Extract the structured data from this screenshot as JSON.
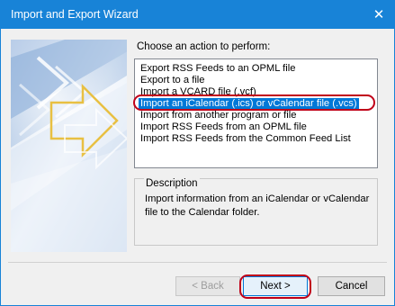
{
  "window": {
    "title": "Import and Export Wizard",
    "close_glyph": "✕",
    "accent_color": "#1883d7"
  },
  "prompt": "Choose an action to perform:",
  "actions": [
    {
      "label": "Export RSS Feeds to an OPML file",
      "selected": false
    },
    {
      "label": "Export to a file",
      "selected": false
    },
    {
      "label": "Import a VCARD file (.vcf)",
      "selected": false
    },
    {
      "label": "Import an iCalendar (.ics) or vCalendar file (.vcs)",
      "selected": true
    },
    {
      "label": "Import from another program or file",
      "selected": false
    },
    {
      "label": "Import RSS Feeds from an OPML file",
      "selected": false
    },
    {
      "label": "Import RSS Feeds from the Common Feed List",
      "selected": false
    }
  ],
  "description": {
    "heading": "Description",
    "text": "Import information from an iCalendar or vCalendar file to the Calendar folder."
  },
  "buttons": {
    "back": "< Back",
    "next": "Next >",
    "cancel": "Cancel"
  },
  "annotation_color": "#c00018",
  "selection_color": "#0078d7"
}
